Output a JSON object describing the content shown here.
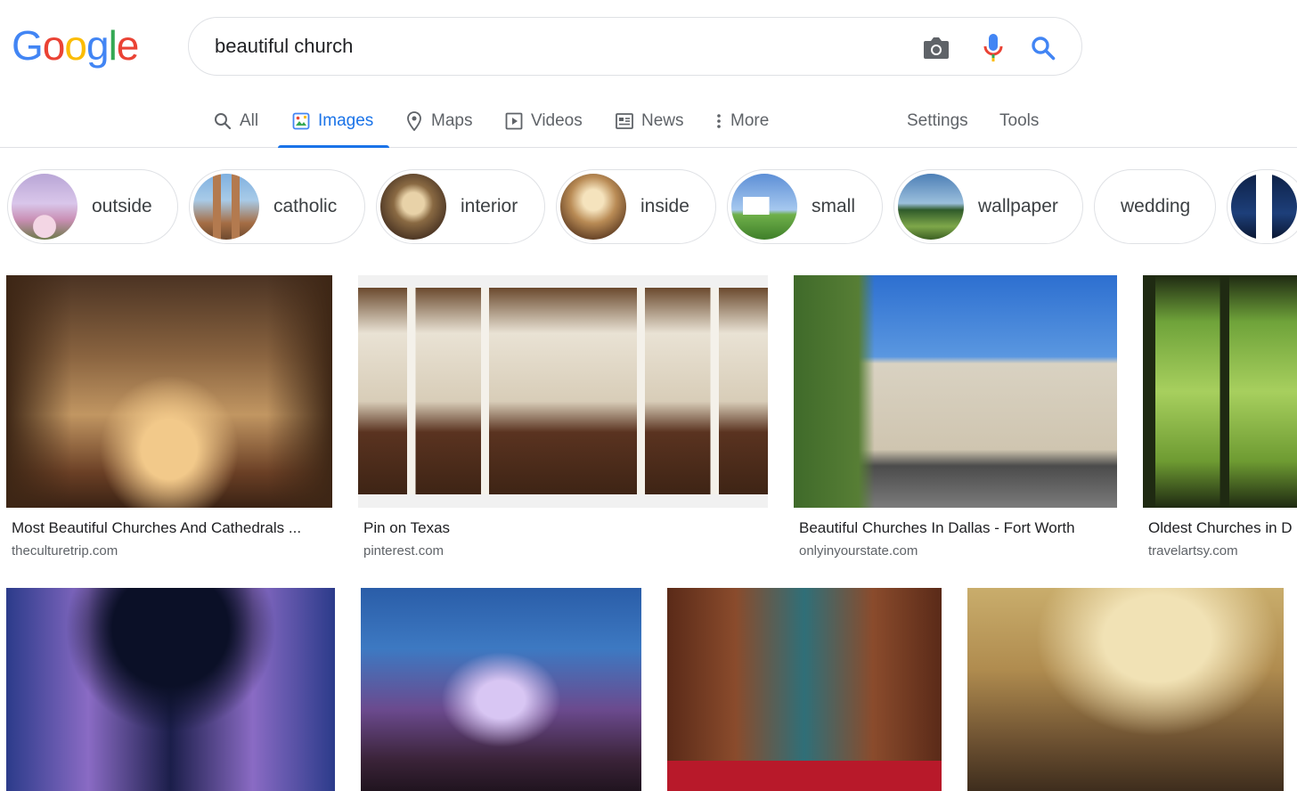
{
  "logo": {
    "letters": [
      "G",
      "o",
      "o",
      "g",
      "l",
      "e"
    ],
    "colors": [
      "#4285F4",
      "#EA4335",
      "#FBBC05",
      "#4285F4",
      "#34A853",
      "#EA4335"
    ]
  },
  "search": {
    "value": "beautiful church",
    "placeholder": ""
  },
  "tabs": [
    {
      "label": "All",
      "icon": "search-icon"
    },
    {
      "label": "Images",
      "icon": "image-icon",
      "active": true
    },
    {
      "label": "Maps",
      "icon": "map-pin-icon"
    },
    {
      "label": "Videos",
      "icon": "video-icon"
    },
    {
      "label": "News",
      "icon": "news-icon"
    },
    {
      "label": "More",
      "icon": "more-vert-icon"
    }
  ],
  "tools": {
    "settings": "Settings",
    "tools": "Tools"
  },
  "chips": [
    {
      "label": "outside"
    },
    {
      "label": "catholic"
    },
    {
      "label": "interior"
    },
    {
      "label": "inside"
    },
    {
      "label": "small"
    },
    {
      "label": "wallpaper"
    },
    {
      "label": "wedding"
    },
    {
      "label": ""
    }
  ],
  "results": [
    {
      "title": "Most Beautiful Churches And Cathedrals ...",
      "source": "theculturetrip.com"
    },
    {
      "title": "Pin on Texas",
      "source": "pinterest.com"
    },
    {
      "title": "Beautiful Churches In Dallas - Fort Worth",
      "source": "onlyinyourstate.com"
    },
    {
      "title": "Oldest Churches in D",
      "source": "travelartsy.com"
    },
    {
      "title": "",
      "source": ""
    },
    {
      "title": "",
      "source": ""
    },
    {
      "title": "",
      "source": ""
    },
    {
      "title": "",
      "source": ""
    }
  ],
  "colors": {
    "accent": "#1a73e8",
    "text_secondary": "#5f6368",
    "border": "#dfe1e5"
  }
}
